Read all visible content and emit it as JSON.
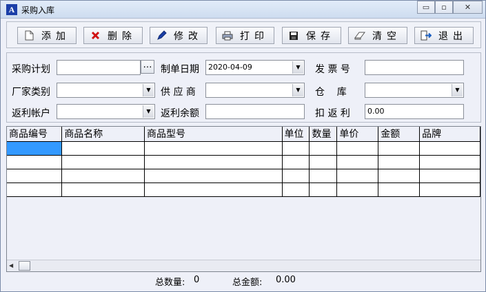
{
  "window": {
    "title": "采购入库",
    "icon_glyph": "A",
    "controls": {
      "minimize": "▭",
      "restore": "▫",
      "close": "✕"
    }
  },
  "toolbar": {
    "add": "添加",
    "delete": "删除",
    "edit": "修改",
    "print": "打印",
    "save": "保存",
    "clear": "清空",
    "exit": "退出"
  },
  "form": {
    "purchase_plan_label": "采购计划",
    "purchase_plan_value": "",
    "ellipsis": "…",
    "date_label": "制单日期",
    "date_value": "2020-04-09",
    "invoice_label": "发 票 号",
    "invoice_value": "",
    "vendor_type_label": "厂家类别",
    "vendor_type_value": "",
    "supplier_label": "供 应 商",
    "supplier_value": "",
    "warehouse_label": "仓    库",
    "warehouse_value": "",
    "rebate_account_label": "返利帐户",
    "rebate_account_value": "",
    "rebate_balance_label": "返利余额",
    "rebate_balance_value": "",
    "rebate_deduct_label": "扣 返 利",
    "rebate_deduct_value": "0.00"
  },
  "grid": {
    "columns": [
      "商品编号",
      "商品名称",
      "商品型号",
      "单位",
      "数量",
      "单价",
      "金额",
      "品牌"
    ],
    "rows": [
      [
        "",
        "",
        "",
        "",
        "",
        "",
        "",
        ""
      ],
      [
        "",
        "",
        "",
        "",
        "",
        "",
        "",
        ""
      ],
      [
        "",
        "",
        "",
        "",
        "",
        "",
        "",
        ""
      ],
      [
        "",
        "",
        "",
        "",
        "",
        "",
        "",
        ""
      ]
    ]
  },
  "footer": {
    "total_qty_label": "总数量:",
    "total_qty_value": "0",
    "total_amount_label": "总金额:",
    "total_amount_value": "0.00"
  },
  "colors": {
    "selection": "#3399ff",
    "window_bg": "#eef0f8",
    "icon_blue": "#1b3fa8",
    "delete_red": "#d01010"
  }
}
